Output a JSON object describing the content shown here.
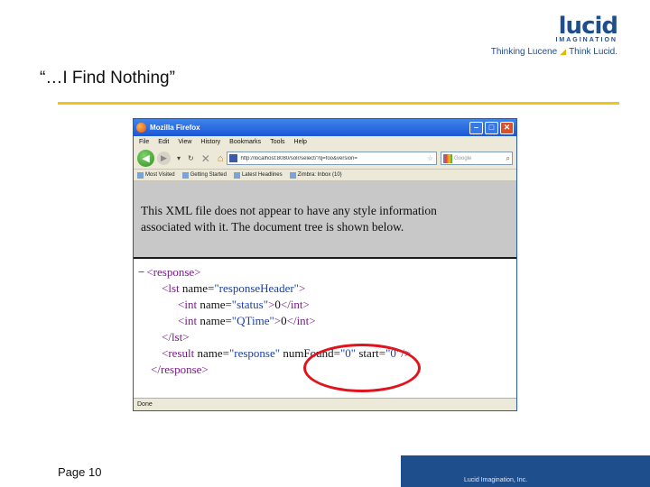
{
  "logo": {
    "word": "lucid",
    "sub": "IMAGINATION"
  },
  "tagline": {
    "left": "Thinking Lucene",
    "right": "Think Lucid."
  },
  "slide": {
    "title": "“…I Find Nothing”",
    "page": "Page 10",
    "footer": "Lucid Imagination, Inc."
  },
  "browser": {
    "title": "Mozilla Firefox",
    "menu": [
      "File",
      "Edit",
      "View",
      "History",
      "Bookmarks",
      "Tools",
      "Help"
    ],
    "url": "http://localhost:8080/solr/select/?q=foo&version=",
    "search_placeholder": "Google",
    "bookmarks": [
      "Most Visited",
      "Getting Started",
      "Latest Headlines",
      "Zimbra: Inbox (10)"
    ],
    "notice_line1": "This XML file does not appear to have any style information",
    "notice_line2": "associated with it. The document tree is shown below.",
    "status": "Done"
  },
  "xml": {
    "minus": "−",
    "response_open": "<response>",
    "lst_open": "<lst",
    "lst_attr": "name=",
    "lst_val": "\"responseHeader\"",
    "lst_close": ">",
    "int1_open": "<int",
    "int1_attr": "name=",
    "int1_val": "\"status\"",
    "int1_gt": ">",
    "int1_text": "0",
    "int1_close": "</int>",
    "int2_open": "<int",
    "int2_attr": "name=",
    "int2_val": "\"QTime\"",
    "int2_gt": ">",
    "int2_text": "0",
    "int2_close": "</int>",
    "lst_end": "</lst>",
    "result_open": "<result",
    "result_attr1": "name=",
    "result_val1": "\"response\"",
    "result_attr2": "numFound=",
    "result_val2": "\"0\"",
    "result_attr3": "start=",
    "result_val3": "\"0\"",
    "result_close": "/>",
    "response_close": "</response>"
  },
  "colors": {
    "brand": "#1f4e8c",
    "accent": "#f0c419",
    "highlight": "#e0141e"
  }
}
